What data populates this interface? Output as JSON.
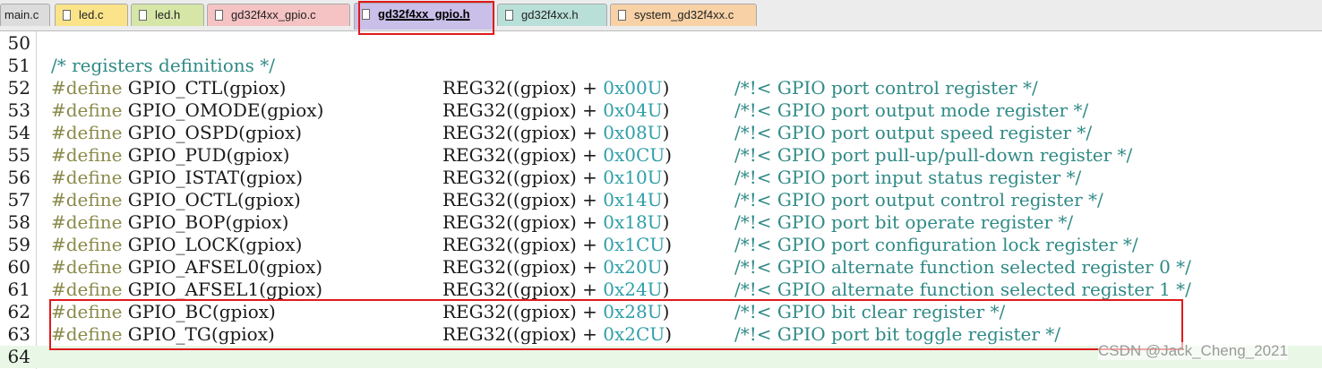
{
  "tabs": [
    {
      "label": "main.c",
      "color": "#dcdcdc",
      "icon": "file-icon",
      "active": false
    },
    {
      "label": "led.c",
      "color": "#fbe38a",
      "icon": "file-icon",
      "active": false
    },
    {
      "label": "led.h",
      "color": "#d6e6a6",
      "icon": "file-icon",
      "active": false
    },
    {
      "label": "gd32f4xx_gpio.c",
      "color": "#f5c3c3",
      "icon": "file-icon",
      "active": false
    },
    {
      "label": "gd32f4xx_gpio.h",
      "color": "#c9bfe9",
      "icon": "file-icon",
      "active": true
    },
    {
      "label": "gd32f4xx.h",
      "color": "#b9e0d8",
      "icon": "file-icon",
      "active": false
    },
    {
      "label": "system_gd32f4xx.c",
      "color": "#f8d2a6",
      "icon": "file-icon",
      "active": false
    }
  ],
  "editor": {
    "lines": [
      {
        "num": "50",
        "kind": "blank",
        "text": ""
      },
      {
        "num": "51",
        "kind": "comment",
        "text": "/* registers definitions */"
      },
      {
        "num": "52",
        "kind": "define",
        "kw": "#define",
        "name": " GPIO_CTL(gpiox)",
        "expr": "REG32((gpiox) + ",
        "hex": "0x00U",
        "close": ")",
        "comment": "/*!< GPIO port control register */"
      },
      {
        "num": "53",
        "kind": "define",
        "kw": "#define",
        "name": " GPIO_OMODE(gpiox)",
        "expr": "REG32((gpiox) + ",
        "hex": "0x04U",
        "close": ")",
        "comment": "/*!< GPIO port output mode register */"
      },
      {
        "num": "54",
        "kind": "define",
        "kw": "#define",
        "name": " GPIO_OSPD(gpiox)",
        "expr": "REG32((gpiox) + ",
        "hex": "0x08U",
        "close": ")",
        "comment": "/*!< GPIO port output speed register */"
      },
      {
        "num": "55",
        "kind": "define",
        "kw": "#define",
        "name": " GPIO_PUD(gpiox)",
        "expr": "REG32((gpiox) + ",
        "hex": "0x0CU",
        "close": ")",
        "comment": "/*!< GPIO port pull-up/pull-down register */"
      },
      {
        "num": "56",
        "kind": "define",
        "kw": "#define",
        "name": " GPIO_ISTAT(gpiox)",
        "expr": "REG32((gpiox) + ",
        "hex": "0x10U",
        "close": ")",
        "comment": "/*!< GPIO port input status register */"
      },
      {
        "num": "57",
        "kind": "define",
        "kw": "#define",
        "name": " GPIO_OCTL(gpiox)",
        "expr": "REG32((gpiox) + ",
        "hex": "0x14U",
        "close": ")",
        "comment": "/*!< GPIO port output control register */"
      },
      {
        "num": "58",
        "kind": "define",
        "kw": "#define",
        "name": " GPIO_BOP(gpiox)",
        "expr": "REG32((gpiox) + ",
        "hex": "0x18U",
        "close": ")",
        "comment": "/*!< GPIO port bit operate register */"
      },
      {
        "num": "59",
        "kind": "define",
        "kw": "#define",
        "name": " GPIO_LOCK(gpiox)",
        "expr": "REG32((gpiox) + ",
        "hex": "0x1CU",
        "close": ")",
        "comment": "/*!< GPIO port configuration lock register */"
      },
      {
        "num": "60",
        "kind": "define",
        "kw": "#define",
        "name": " GPIO_AFSEL0(gpiox)",
        "expr": "REG32((gpiox) + ",
        "hex": "0x20U",
        "close": ")",
        "comment": "/*!< GPIO alternate function selected register 0 */"
      },
      {
        "num": "61",
        "kind": "define",
        "kw": "#define",
        "name": " GPIO_AFSEL1(gpiox)",
        "expr": "REG32((gpiox) + ",
        "hex": "0x24U",
        "close": ")",
        "comment": "/*!< GPIO alternate function selected register 1 */"
      },
      {
        "num": "62",
        "kind": "define",
        "kw": "#define",
        "name": " GPIO_BC(gpiox)",
        "expr": "REG32((gpiox) + ",
        "hex": "0x28U",
        "close": ")",
        "comment": "/*!< GPIO bit clear register */"
      },
      {
        "num": "63",
        "kind": "define",
        "kw": "#define",
        "name": " GPIO_TG(gpiox)",
        "expr": "REG32((gpiox) + ",
        "hex": "0x2CU",
        "close": ")",
        "comment": "/*!< GPIO port bit toggle register */"
      },
      {
        "num": "64",
        "kind": "blank",
        "text": "",
        "highlight": true
      }
    ]
  },
  "watermark": "CSDN @Jack_Cheng_2021",
  "colors": {
    "keyword": "#8a8a4a",
    "hex_literal": "#2f9fa8",
    "comment": "#2f8a86",
    "annotation_box": "#e01a1a",
    "current_line": "#e9f8e6"
  }
}
